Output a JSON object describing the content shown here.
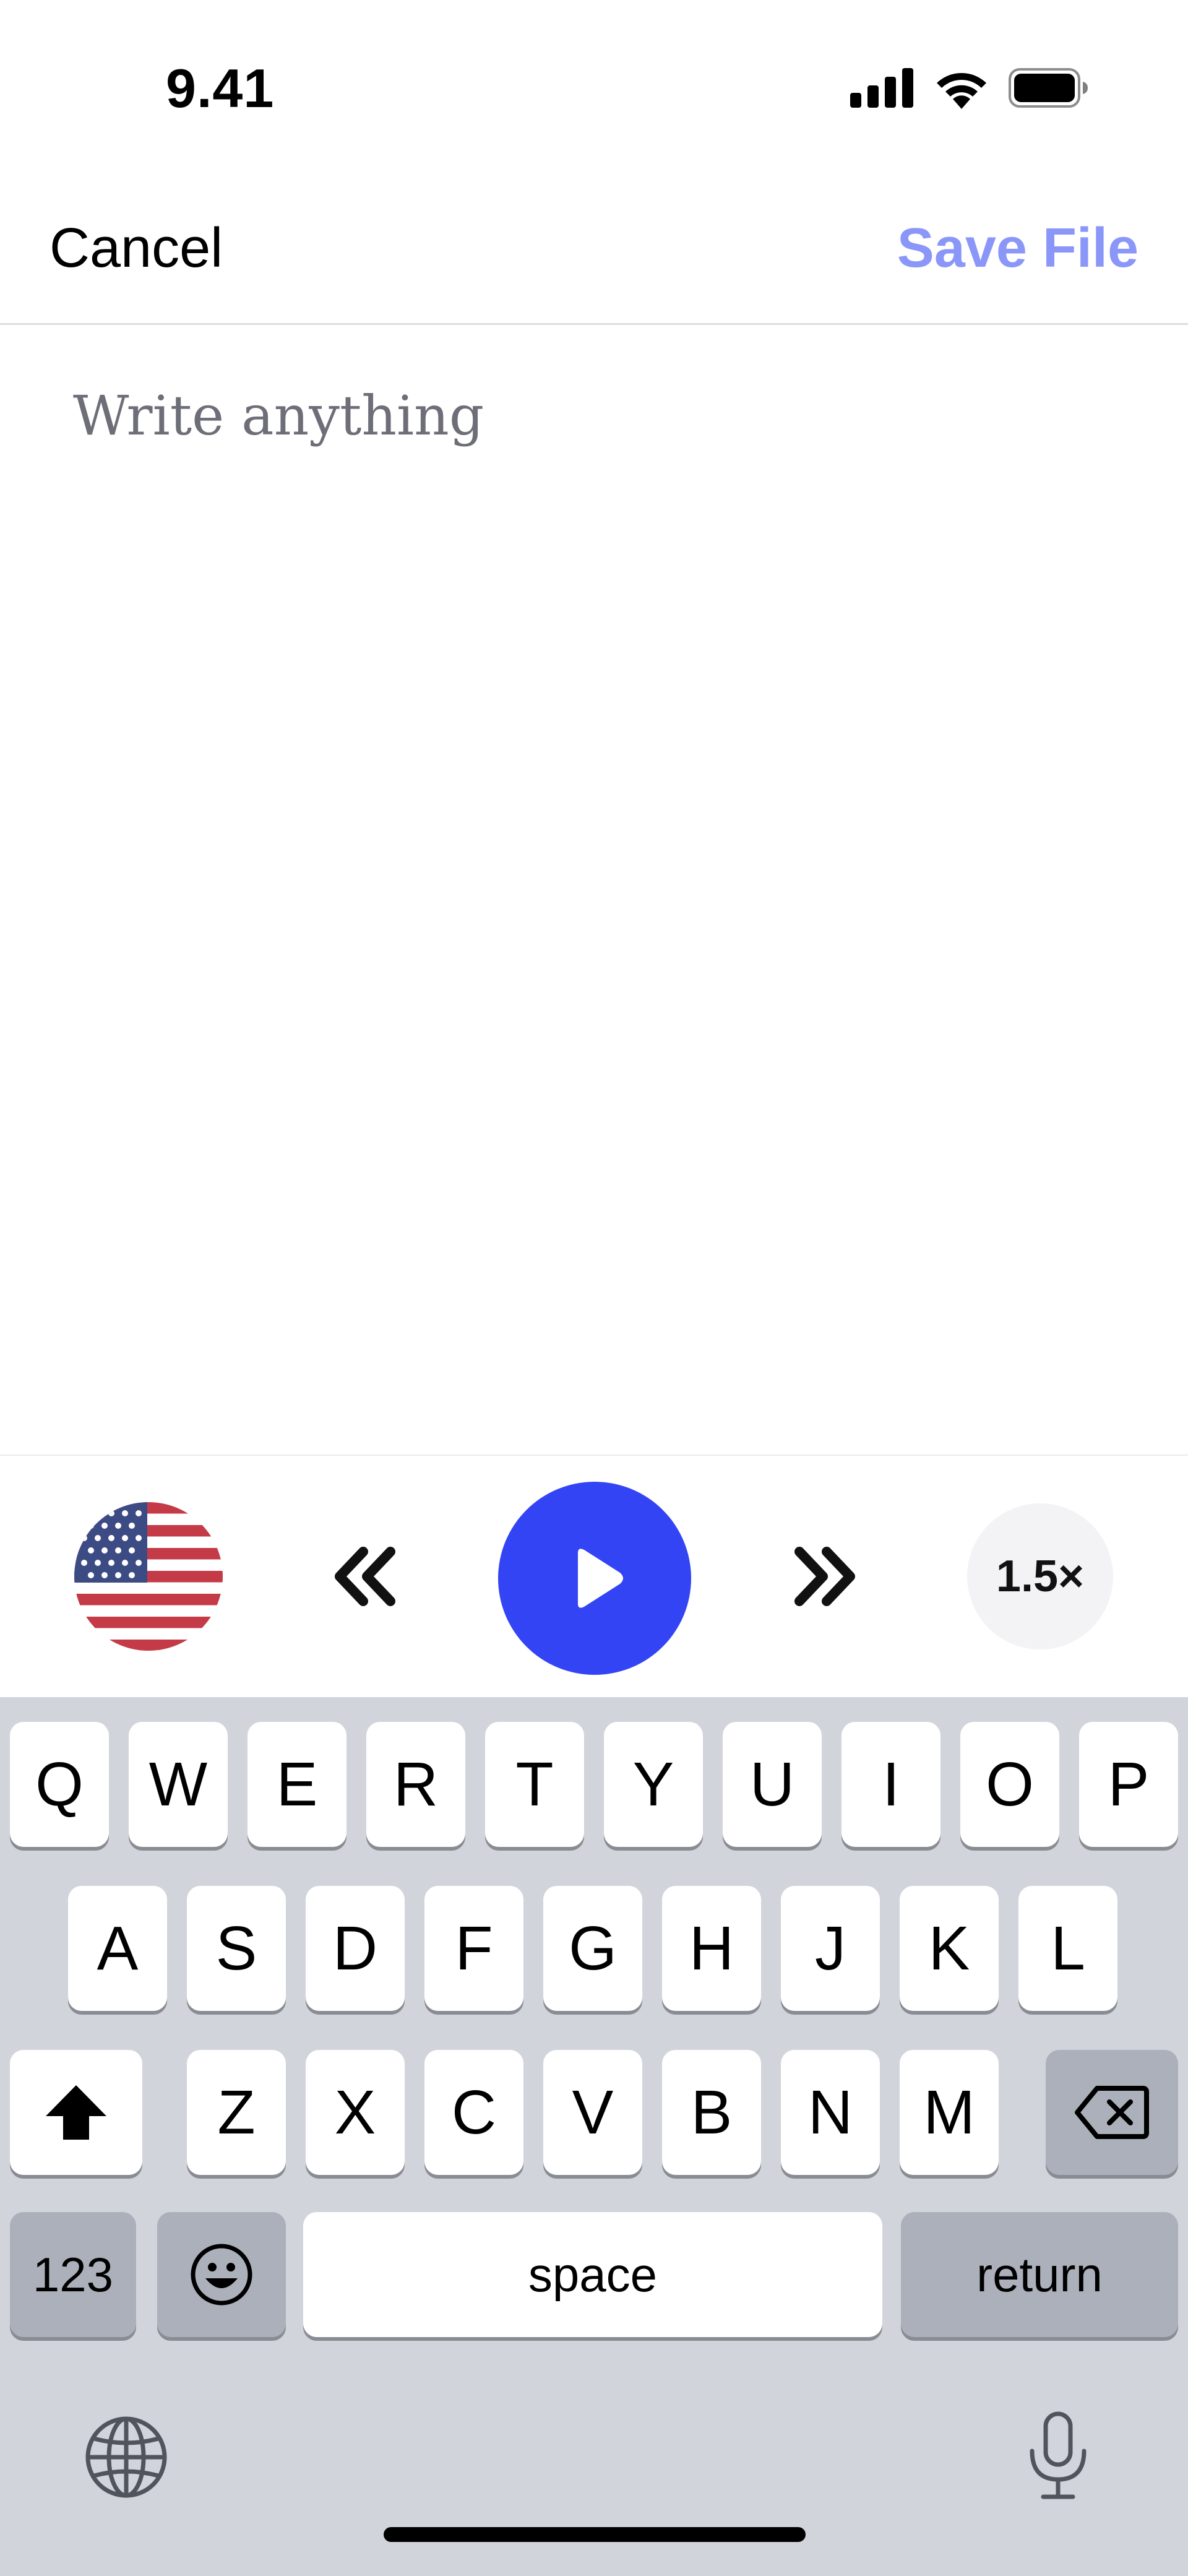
{
  "status_bar": {
    "time": "9.41"
  },
  "nav": {
    "cancel_label": "Cancel",
    "save_label": "Save File"
  },
  "editor": {
    "placeholder": "Write anything",
    "value": ""
  },
  "player": {
    "speed_label": "1.5×",
    "language_flag": "us-flag"
  },
  "keyboard": {
    "row1": [
      "Q",
      "W",
      "E",
      "R",
      "T",
      "Y",
      "U",
      "I",
      "O",
      "P"
    ],
    "row2": [
      "A",
      "S",
      "D",
      "F",
      "G",
      "H",
      "J",
      "K",
      "L"
    ],
    "row3": [
      "Z",
      "X",
      "C",
      "V",
      "B",
      "N",
      "M"
    ],
    "numbers_label": "123",
    "space_label": "space",
    "return_label": "return"
  },
  "colors": {
    "accent": "#3344f5",
    "save_disabled": "#8a97f8",
    "keyboard_bg": "#d1d4db"
  }
}
